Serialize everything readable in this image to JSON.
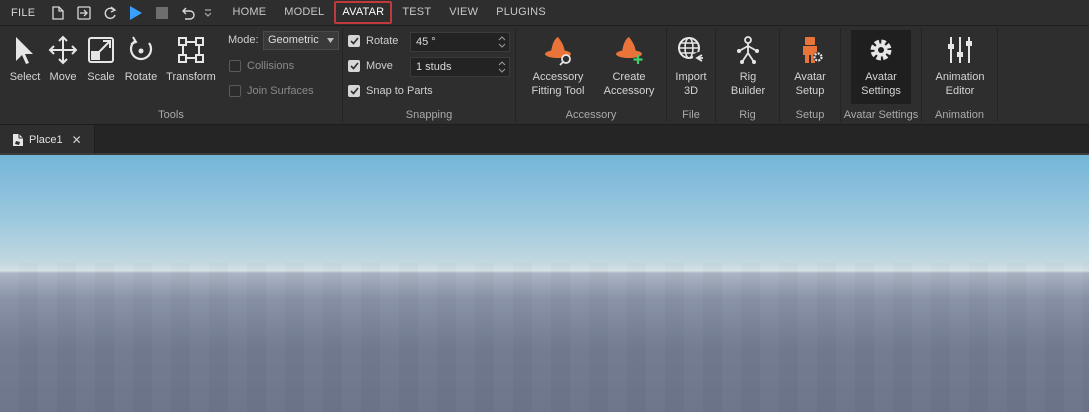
{
  "menubar": {
    "file_label": "FILE",
    "tabs": [
      {
        "label": "HOME"
      },
      {
        "label": "MODEL"
      },
      {
        "label": "AVATAR"
      },
      {
        "label": "TEST"
      },
      {
        "label": "VIEW"
      },
      {
        "label": "PLUGINS"
      }
    ],
    "active_tab": "AVATAR"
  },
  "ribbon": {
    "tools": {
      "label": "Tools",
      "items": [
        {
          "label": "Select",
          "icon": "cursor-arrow-icon"
        },
        {
          "label": "Move",
          "icon": "move-arrows-icon"
        },
        {
          "label": "Scale",
          "icon": "scale-icon"
        },
        {
          "label": "Rotate",
          "icon": "rotate-icon"
        },
        {
          "label": "Transform",
          "icon": "transform-icon"
        }
      ],
      "mode_label": "Mode:",
      "mode_value": "Geometric",
      "collisions_label": "Collisions",
      "collisions_checked": false,
      "join_surfaces_label": "Join Surfaces",
      "join_surfaces_checked": false
    },
    "snapping": {
      "label": "Snapping",
      "rotate_label": "Rotate",
      "rotate_checked": true,
      "rotate_value": "45 °",
      "move_label": "Move",
      "move_checked": true,
      "move_value": "1 studs",
      "snap_to_parts_label": "Snap to Parts",
      "snap_to_parts_checked": true
    },
    "accessory": {
      "label": "Accessory",
      "fitting_tool": "Accessory Fitting Tool",
      "fitting_tool_line1": "Accessory",
      "fitting_tool_line2": "Fitting Tool",
      "create_line1": "Create",
      "create_line2": "Accessory"
    },
    "file": {
      "label": "File",
      "import_line1": "Import",
      "import_line2": "3D"
    },
    "rig": {
      "label": "Rig",
      "builder_line1": "Rig",
      "builder_line2": "Builder"
    },
    "setup": {
      "label": "Setup",
      "avatar_setup_line1": "Avatar",
      "avatar_setup_line2": "Setup"
    },
    "avatar_settings": {
      "label": "Avatar Settings",
      "line1": "Avatar",
      "line2": "Settings"
    },
    "animation": {
      "label": "Animation",
      "line1": "Animation",
      "line2": "Editor"
    }
  },
  "document": {
    "tab_name": "Place1",
    "close_glyph": "✕"
  },
  "colors": {
    "accent_play": "#3aa0ff",
    "accessory_orange": "#e8743a",
    "active_tab_outline": "#c0393b",
    "create_plus": "#3ad16b"
  }
}
